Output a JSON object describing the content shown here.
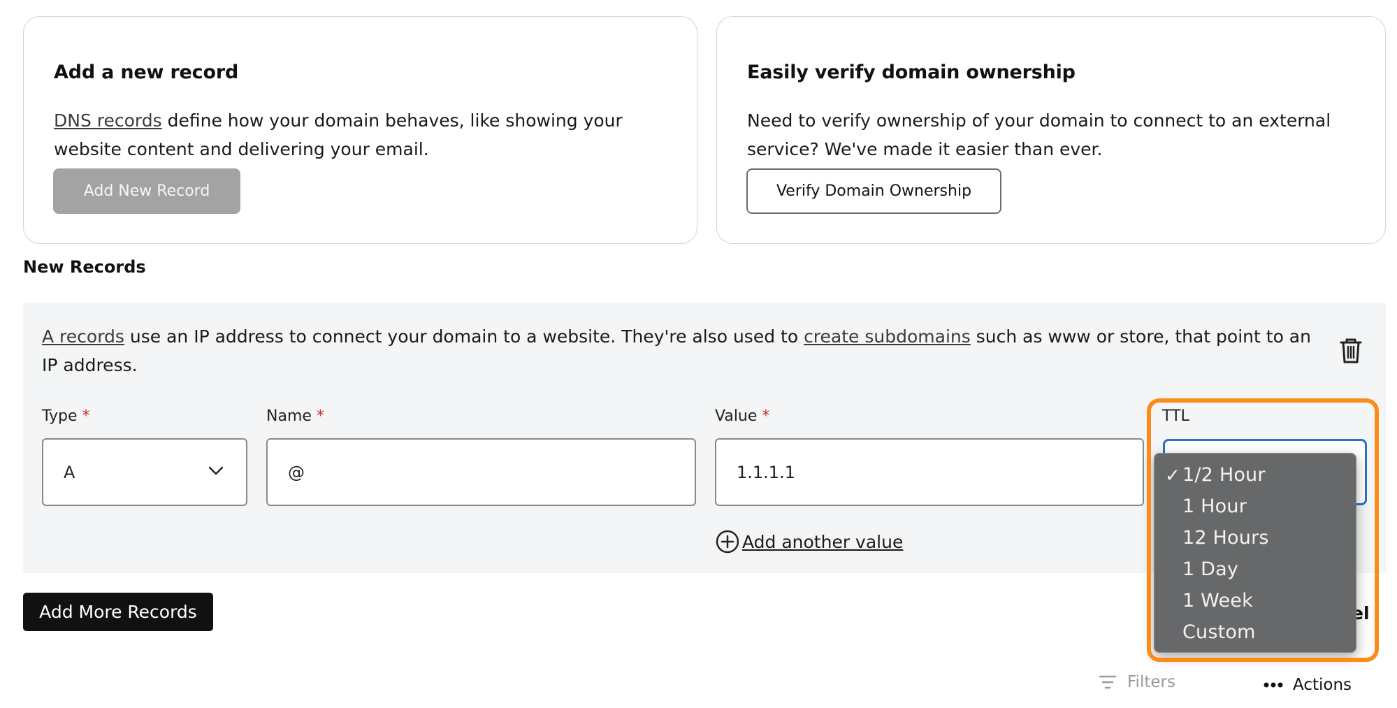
{
  "add_record_card": {
    "title": "Add a new record",
    "link_text": "DNS records",
    "text": " define how your domain behaves, like showing your website content and delivering your email.",
    "button_label": "Add New Record"
  },
  "verify_card": {
    "title": "Easily verify domain ownership",
    "text": "Need to verify ownership of your domain to connect to an external service? We've made it easier than ever.",
    "button_label": "Verify Domain Ownership"
  },
  "new_records": {
    "title": "New Records",
    "description": {
      "link1": "A records",
      "text1": " use an IP address to connect your domain to a website. They're also used to ",
      "link2": "create subdomains",
      "text2": " such as www or store, that point to an IP address."
    },
    "fields": {
      "type": {
        "label": "Type",
        "required_mark": "*",
        "value": "A"
      },
      "name": {
        "label": "Name",
        "required_mark": "*",
        "value": "@"
      },
      "value": {
        "label": "Value",
        "required_mark": "*",
        "value": "1.1.1.1"
      },
      "ttl": {
        "label": "TTL"
      }
    },
    "add_value_label": "Add another value"
  },
  "ttl_dropdown": {
    "check": "✓",
    "selected_index": 0,
    "options": [
      "1/2 Hour",
      "1 Hour",
      "12 Hours",
      "1 Day",
      "1 Week",
      "Custom"
    ]
  },
  "footer": {
    "add_more_label": "Add More Records",
    "cancel_partial": "el",
    "filters_label": "Filters",
    "actions_label": "Actions"
  },
  "colors": {
    "highlight": "#fb8c1a",
    "required": "#d52a2a",
    "focus_border": "#2f6fbf"
  }
}
